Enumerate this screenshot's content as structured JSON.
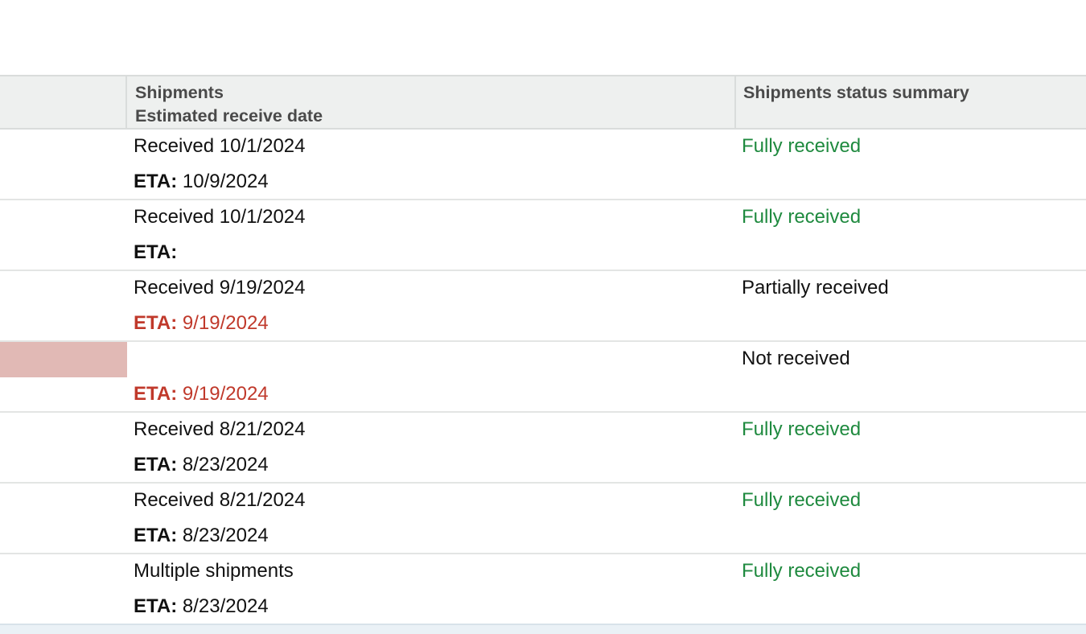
{
  "table": {
    "headers": {
      "shipments_line1": "Shipments",
      "shipments_line2": "Estimated receive date",
      "status": "Shipments status summary"
    },
    "rows": [
      {
        "received": "Received 10/1/2024",
        "eta_label": "ETA:",
        "eta_value": " 10/9/2024",
        "status": "Fully received",
        "status_kind": "fully",
        "overdue": false,
        "flag": false
      },
      {
        "received": "Received 10/1/2024",
        "eta_label": "ETA:",
        "eta_value": "",
        "status": "Fully received",
        "status_kind": "fully",
        "overdue": false,
        "flag": false
      },
      {
        "received": "Received 9/19/2024",
        "eta_label": "ETA:",
        "eta_value": " 9/19/2024",
        "status": "Partially received",
        "status_kind": "other",
        "overdue": true,
        "flag": false
      },
      {
        "received": "",
        "eta_label": "ETA:",
        "eta_value": " 9/19/2024",
        "status": "Not received",
        "status_kind": "other",
        "overdue": true,
        "flag": true
      },
      {
        "received": "Received 8/21/2024",
        "eta_label": "ETA:",
        "eta_value": " 8/23/2024",
        "status": "Fully received",
        "status_kind": "fully",
        "overdue": false,
        "flag": false
      },
      {
        "received": "Received 8/21/2024",
        "eta_label": "ETA:",
        "eta_value": " 8/23/2024",
        "status": "Fully received",
        "status_kind": "fully",
        "overdue": false,
        "flag": false
      },
      {
        "received": "Multiple shipments",
        "eta_label": "ETA:",
        "eta_value": " 8/23/2024",
        "status": "Fully received",
        "status_kind": "fully",
        "overdue": false,
        "flag": false
      }
    ]
  },
  "colors": {
    "fully_received": "#1f8a3f",
    "overdue": "#c0392b",
    "flag_cell": "#e1b9b5",
    "header_bg": "#eef0ef"
  }
}
